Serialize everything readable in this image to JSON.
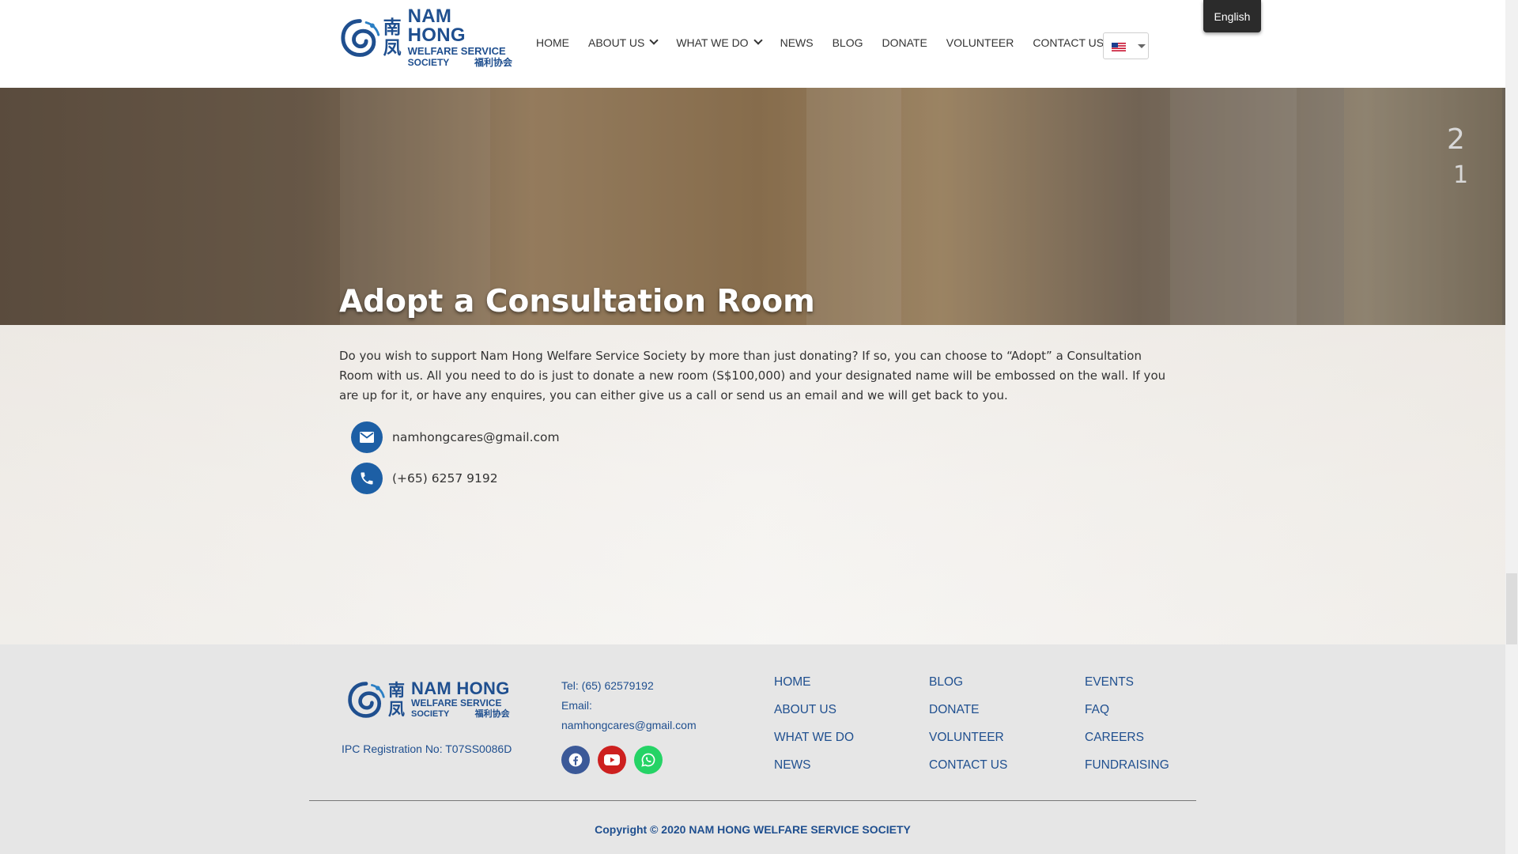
{
  "brand": {
    "han": [
      "南",
      "凤"
    ],
    "name": "NAM HONG",
    "sub": "WELFARE SERVICE",
    "sub2_left": "SOCIETY",
    "sub2_han": "福利协会",
    "color": "#1f4f8f"
  },
  "nav": {
    "items": [
      {
        "label": "HOME"
      },
      {
        "label": "ABOUT US",
        "has_dropdown": true
      },
      {
        "label": "WHAT WE DO",
        "has_dropdown": true
      },
      {
        "label": "NEWS"
      },
      {
        "label": "BLOG"
      },
      {
        "label": "DONATE"
      },
      {
        "label": "VOLUNTEER"
      },
      {
        "label": "CONTACT US"
      }
    ],
    "language_flag": "us-flag-icon",
    "language_button": "English"
  },
  "hero": {
    "title": "Adopt a Consultation Room",
    "sign_numbers": [
      "2",
      "1"
    ]
  },
  "content": {
    "intro": "Do you wish to support Nam Hong Welfare Service Society by more than just donating? If so, you can choose to “Adopt” a Consultation Room with us. All you need to do is just to donate a new room (S$100,000) and your designated name will be embossed on the wall. If you are up for it, or have any enquires, you can either give us a call or send us an email and we will get back to you.",
    "email": "namhongcares@gmail.com",
    "phone": "(+65) 6257 9192",
    "accent_color": "#1d5fa5"
  },
  "footer": {
    "ipc": "IPC Registration No: T07SS0086D",
    "tel": "Tel: (65) 62579192",
    "email_label": "Email:",
    "email": "namhongcares@gmail.com",
    "socials": [
      "facebook-icon",
      "youtube-icon",
      "whatsapp-icon"
    ],
    "col1": [
      "HOME",
      "ABOUT US",
      "WHAT WE DO",
      "NEWS"
    ],
    "col2": [
      "BLOG",
      "DONATE",
      "VOLUNTEER",
      "CONTACT US"
    ],
    "col3": [
      "EVENTS",
      "FAQ",
      "CAREERS",
      "FUNDRAISING"
    ],
    "copyright": "Copyright © 2020 NAM HONG WELFARE SERVICE SOCIETY"
  }
}
